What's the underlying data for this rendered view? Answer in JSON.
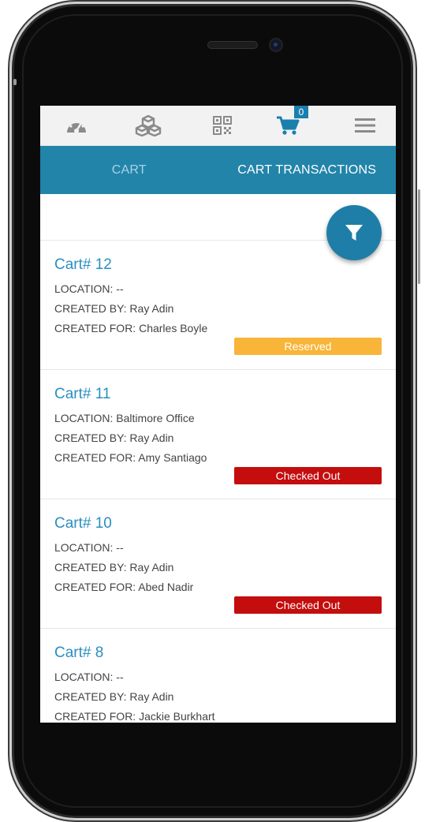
{
  "nav": {
    "icons": [
      "dashboard-icon",
      "boxes-icon",
      "qr-code-icon",
      "cart-icon",
      "menu-icon"
    ],
    "cart_count": "0"
  },
  "tabs": {
    "cart": "CART",
    "transactions": "CART TRANSACTIONS"
  },
  "colors": {
    "accent": "#2384aa",
    "title": "#2a8fc1",
    "reserved": "#f8b53a",
    "checked_out": "#c40d0d"
  },
  "carts": [
    {
      "title": "Cart# 12",
      "location": "LOCATION: --",
      "created_by": "CREATED BY: Ray Adin",
      "created_for": "CREATED FOR: Charles Boyle",
      "status": "Reserved",
      "status_color": "#f8b53a"
    },
    {
      "title": "Cart# 11",
      "location": "LOCATION: Baltimore Office",
      "created_by": "CREATED BY: Ray Adin",
      "created_for": "CREATED FOR: Amy Santiago",
      "status": "Checked Out",
      "status_color": "#c40d0d"
    },
    {
      "title": "Cart# 10",
      "location": "LOCATION: --",
      "created_by": "CREATED BY: Ray Adin",
      "created_for": "CREATED FOR: Abed Nadir",
      "status": "Checked Out",
      "status_color": "#c40d0d"
    },
    {
      "title": "Cart# 8",
      "location": "LOCATION: --",
      "created_by": "CREATED BY: Ray Adin",
      "created_for": "CREATED FOR: Jackie Burkhart"
    }
  ]
}
